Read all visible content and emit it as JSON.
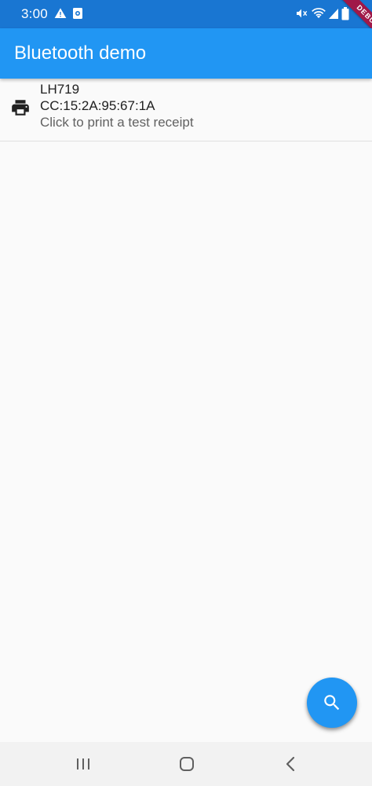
{
  "status_bar": {
    "time": "3:00",
    "icons": [
      "warning-icon",
      "notification-icon",
      "mute-icon",
      "wifi-icon",
      "signal-icon",
      "battery-icon"
    ],
    "background": "#1976d2"
  },
  "debug_banner": {
    "label": "DEBUG",
    "color": "#a01848"
  },
  "app_bar": {
    "title": "Bluetooth demo",
    "background": "#2196f3"
  },
  "devices": [
    {
      "icon": "printer-icon",
      "name": "LH719",
      "address": "CC:15:2A:95:67:1A",
      "subtitle": "Click to print a test receipt"
    }
  ],
  "fab": {
    "icon": "search-icon",
    "color": "#2196f3"
  },
  "nav_bar": {
    "buttons": [
      "recent-apps-icon",
      "home-icon",
      "back-icon"
    ]
  }
}
